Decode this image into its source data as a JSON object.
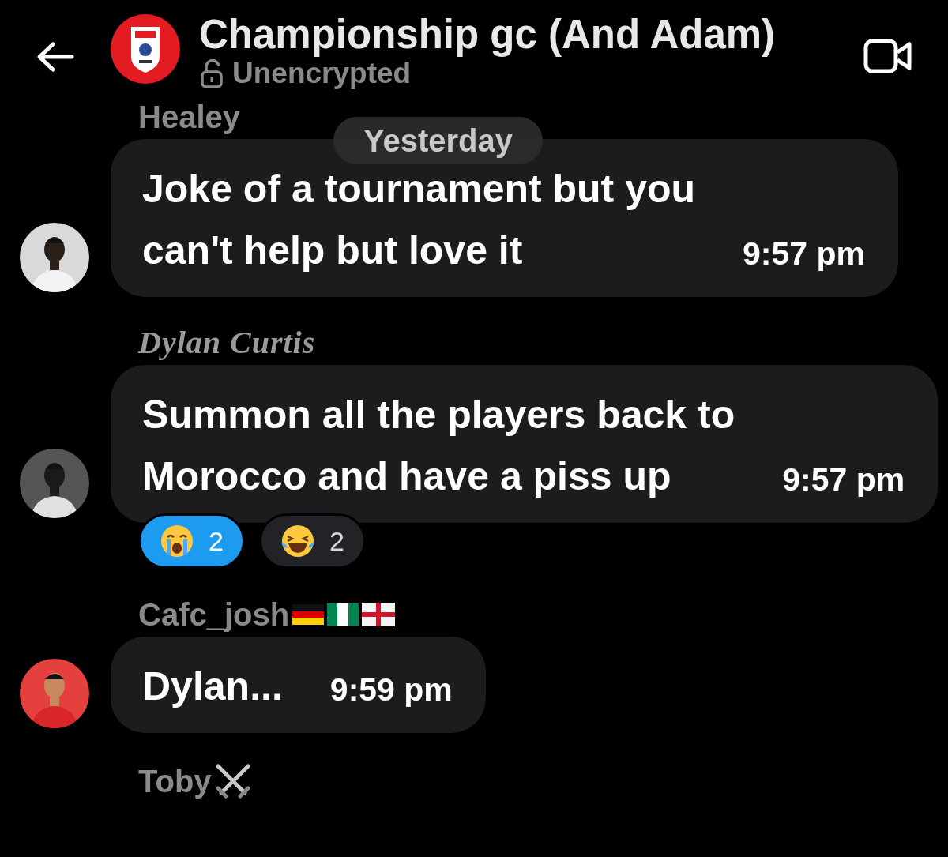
{
  "header": {
    "title": "Championship gc (And Adam)",
    "subtitle": "Unencrypted"
  },
  "date_pill": "Yesterday",
  "messages": [
    {
      "sender": "Healey",
      "kind": "plain",
      "text": "Joke of a tournament but you\ncan't help but love it",
      "time": "9:57 pm"
    },
    {
      "sender": "Dylan Curtis",
      "kind": "script",
      "text": "Summon all the players back to\nMorocco and have a piss up",
      "time": "9:57 pm",
      "reactions": [
        {
          "kind": "crying",
          "count": "2",
          "selected": true
        },
        {
          "kind": "laughing",
          "count": "2",
          "selected": false
        }
      ]
    },
    {
      "sender": "Cafc_josh",
      "kind": "plain",
      "name_icons": [
        {
          "kind": "flag-de"
        },
        {
          "kind": "flag-ng"
        },
        {
          "kind": "flag-en"
        }
      ],
      "text": "Dylan...",
      "time": "9:59 pm"
    },
    {
      "sender": "Toby",
      "kind": "plain",
      "name_icons": [
        {
          "kind": "swords"
        }
      ]
    }
  ]
}
